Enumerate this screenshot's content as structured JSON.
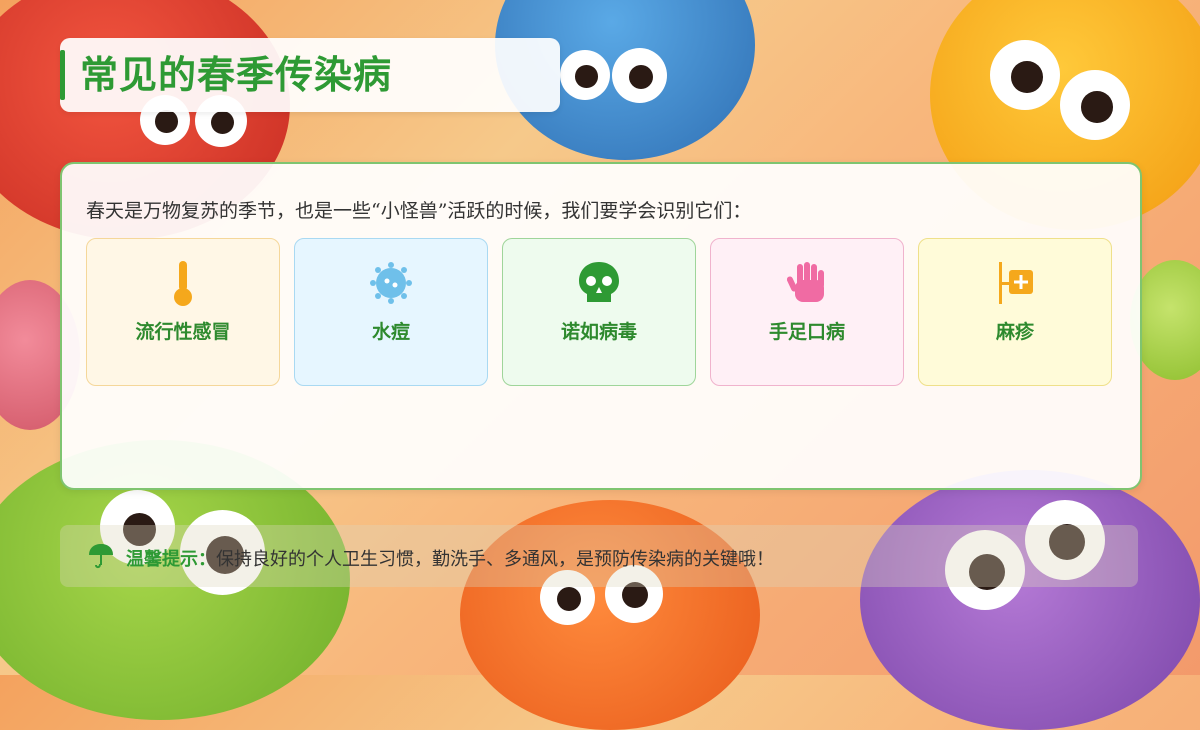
{
  "slide": {
    "title": "常见的春季传染病",
    "intro": "春天是万物复苏的季节，也是一些“小怪兽”活跃的时候，我们要学会识别它们：",
    "diseases": [
      {
        "label": "流行性感冒",
        "icon": "thermometer-icon",
        "color": "#f5a81c"
      },
      {
        "label": "水痘",
        "icon": "virus-icon",
        "color": "#6fc0ea"
      },
      {
        "label": "诺如病毒",
        "icon": "skull-icon",
        "color": "#2e9a34"
      },
      {
        "label": "手足口病",
        "icon": "hand-icon",
        "color": "#f06ba3"
      },
      {
        "label": "麻疹",
        "icon": "medical-sign-icon",
        "color": "#f5a81c"
      }
    ],
    "tip": {
      "icon": "umbrella-icon",
      "label": "温馨提示：",
      "text": "保持良好的个人卫生习惯，勤洗手、多通风，是预防传染病的关键哦！"
    }
  },
  "colors": {
    "accent_green": "#2e9a34",
    "panel_border": "#7fc470"
  }
}
